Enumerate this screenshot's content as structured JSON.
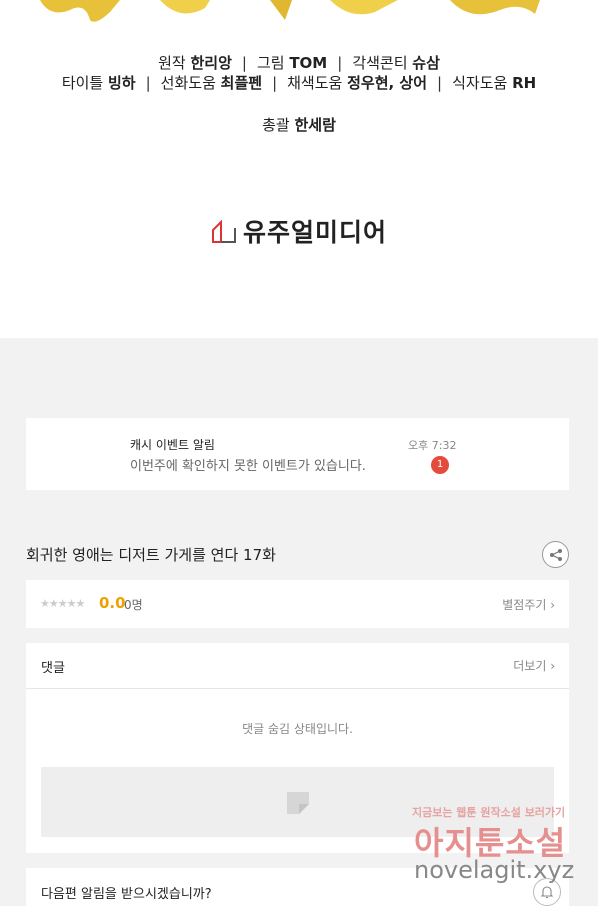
{
  "credits": {
    "line1": [
      {
        "label": "원작",
        "name": "한리앙"
      },
      {
        "label": "그림",
        "name": "TOM"
      },
      {
        "label": "각색콘티",
        "name": "슈삼"
      }
    ],
    "line2": [
      {
        "label": "타이틀",
        "name": "빙하"
      },
      {
        "label": "선화도움",
        "name": "최플펜"
      },
      {
        "label": "채색도움",
        "name": "정우현, 상어"
      },
      {
        "label": "식자도움",
        "name": "RH"
      }
    ],
    "line3": {
      "label": "총괄",
      "name": "한세람"
    }
  },
  "publisher": "유주얼미디어",
  "notice": {
    "title": "캐시 이벤트 알림",
    "text": "이번주에 확인하지 못한 이벤트가 있습니다.",
    "time": "오후 7:32",
    "badge": "1"
  },
  "episode": {
    "title": "회귀한 영애는 디저트 가게를 연다 17화"
  },
  "rating": {
    "stars": "★★★★★",
    "score": "0.0",
    "count": "0명",
    "link": "별점주기 ›"
  },
  "comments": {
    "header": "댓글",
    "more": "더보기 ›",
    "hidden_text": "댓글 숨김 상태입니다."
  },
  "next_alert": {
    "label": "다음편 알림을 받으시겠습니까?"
  },
  "watermark": {
    "top": "지금보는 웹툰 원작소설 보러가기",
    "main": "아지툰소설",
    "url": "novelagit.xyz"
  },
  "colors": {
    "accent": "#f0a000",
    "badge": "#e54b3c",
    "watermark": "#e58f8f"
  }
}
